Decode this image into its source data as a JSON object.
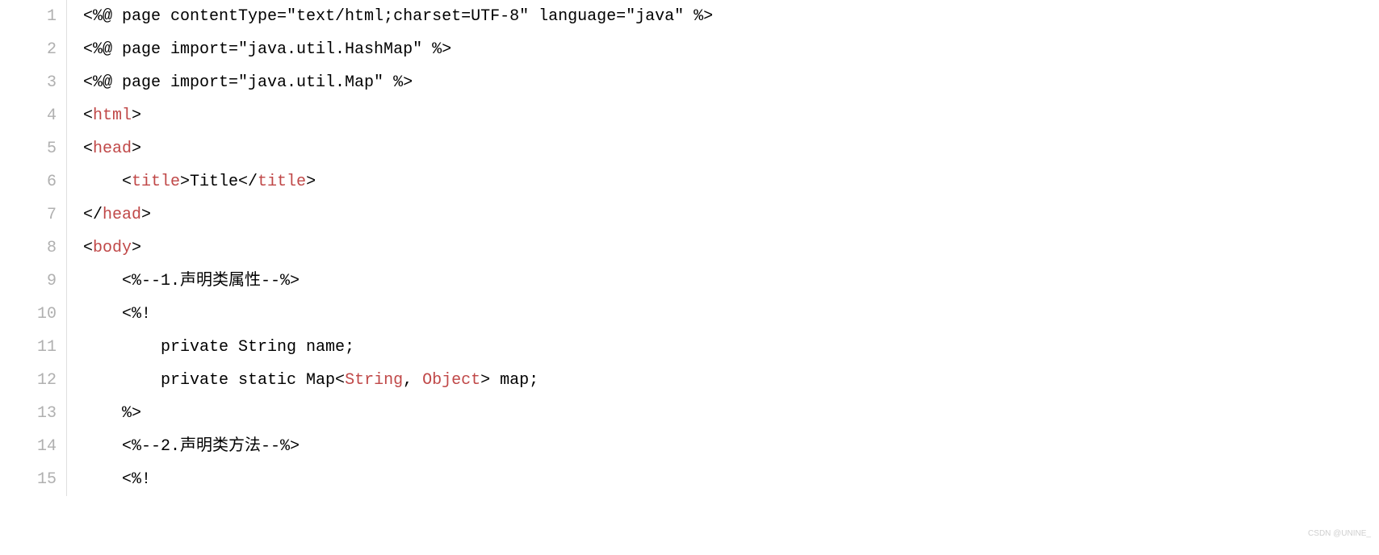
{
  "watermark": "CSDN @UNINE_",
  "colors": {
    "plain": "#000000",
    "tag": "#c04848",
    "keyword": "#c04848",
    "gutter": "#b0b0b0"
  },
  "lines": [
    {
      "num": "1",
      "tokens": [
        {
          "t": "<%@ page contentType=\"text/html;charset=UTF-8\" language=\"java\" %>",
          "c": "plain"
        }
      ]
    },
    {
      "num": "2",
      "tokens": [
        {
          "t": "<%@ page import=\"java.util.HashMap\" %>",
          "c": "plain"
        }
      ]
    },
    {
      "num": "3",
      "tokens": [
        {
          "t": "<%@ page import=\"java.util.Map\" %>",
          "c": "plain"
        }
      ]
    },
    {
      "num": "4",
      "tokens": [
        {
          "t": "<",
          "c": "plain"
        },
        {
          "t": "html",
          "c": "tag"
        },
        {
          "t": ">",
          "c": "plain"
        }
      ]
    },
    {
      "num": "5",
      "tokens": [
        {
          "t": "<",
          "c": "plain"
        },
        {
          "t": "head",
          "c": "tag"
        },
        {
          "t": ">",
          "c": "plain"
        }
      ]
    },
    {
      "num": "6",
      "tokens": [
        {
          "t": "    <",
          "c": "plain"
        },
        {
          "t": "title",
          "c": "tag"
        },
        {
          "t": ">Title</",
          "c": "plain"
        },
        {
          "t": "title",
          "c": "tag"
        },
        {
          "t": ">",
          "c": "plain"
        }
      ]
    },
    {
      "num": "7",
      "tokens": [
        {
          "t": "</",
          "c": "plain"
        },
        {
          "t": "head",
          "c": "tag"
        },
        {
          "t": ">",
          "c": "plain"
        }
      ]
    },
    {
      "num": "8",
      "tokens": [
        {
          "t": "<",
          "c": "plain"
        },
        {
          "t": "body",
          "c": "tag"
        },
        {
          "t": ">",
          "c": "plain"
        }
      ]
    },
    {
      "num": "9",
      "tokens": [
        {
          "t": "    <%--1.声明类属性--%>",
          "c": "plain"
        }
      ]
    },
    {
      "num": "10",
      "tokens": [
        {
          "t": "    <%!",
          "c": "plain"
        }
      ]
    },
    {
      "num": "11",
      "tokens": [
        {
          "t": "        private String name;",
          "c": "plain"
        }
      ]
    },
    {
      "num": "12",
      "tokens": [
        {
          "t": "        private static Map<",
          "c": "plain"
        },
        {
          "t": "String",
          "c": "keyword"
        },
        {
          "t": ", ",
          "c": "plain"
        },
        {
          "t": "Object",
          "c": "keyword"
        },
        {
          "t": "> map;",
          "c": "plain"
        }
      ]
    },
    {
      "num": "13",
      "tokens": [
        {
          "t": "    %>",
          "c": "plain"
        }
      ]
    },
    {
      "num": "14",
      "tokens": [
        {
          "t": "    <%--2.声明类方法--%>",
          "c": "plain"
        }
      ]
    },
    {
      "num": "15",
      "tokens": [
        {
          "t": "    <%!",
          "c": "plain"
        }
      ]
    }
  ]
}
